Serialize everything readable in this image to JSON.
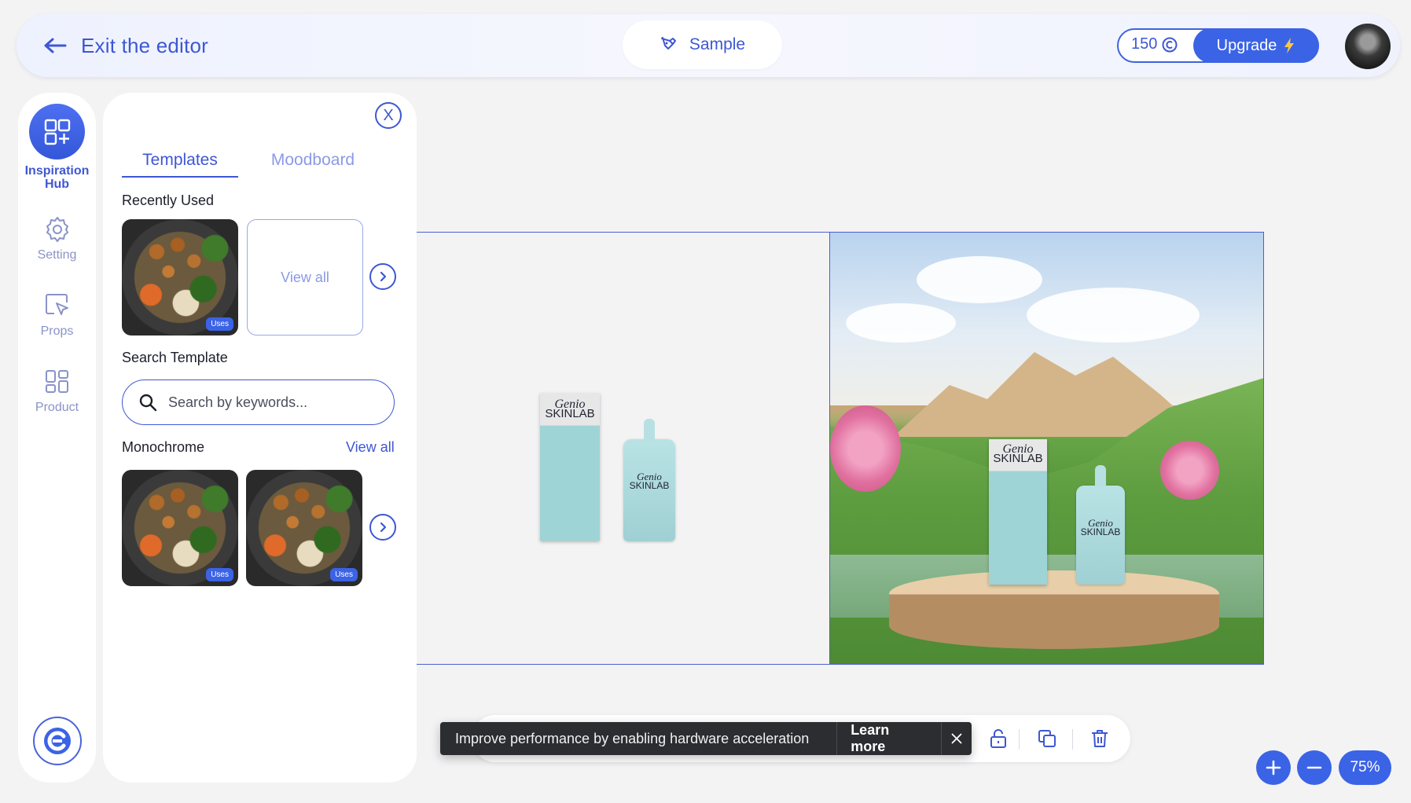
{
  "header": {
    "exit_label": "Exit the editor",
    "sample_label": "Sample",
    "credits": "150",
    "upgrade_label": "Upgrade"
  },
  "rail": {
    "items": [
      {
        "label": "Inspiration Hub",
        "icon": "grid-plus-icon",
        "active": true
      },
      {
        "label": "Setting",
        "icon": "gear-icon"
      },
      {
        "label": "Props",
        "icon": "cursor-frame-icon"
      },
      {
        "label": "Product",
        "icon": "grid-icon"
      }
    ]
  },
  "panel": {
    "close_label": "X",
    "tabs": [
      {
        "label": "Templates",
        "active": true
      },
      {
        "label": "Moodboard"
      }
    ],
    "recently_used_title": "Recently Used",
    "view_all_card": "View all",
    "uses_badge": "Uses",
    "search_title": "Search Template",
    "search_placeholder": "Search by keywords...",
    "monochrome_title": "Monochrome",
    "monochrome_view_all": "View all"
  },
  "canvas": {
    "brand_script": "Genio",
    "brand_name": "SKINLAB"
  },
  "toast": {
    "message": "Improve performance by enabling hardware acceleration",
    "action": "Learn more"
  },
  "zoom": {
    "level": "75%"
  },
  "colors": {
    "accent": "#3b63e6",
    "accent_text": "#3e57d3"
  }
}
